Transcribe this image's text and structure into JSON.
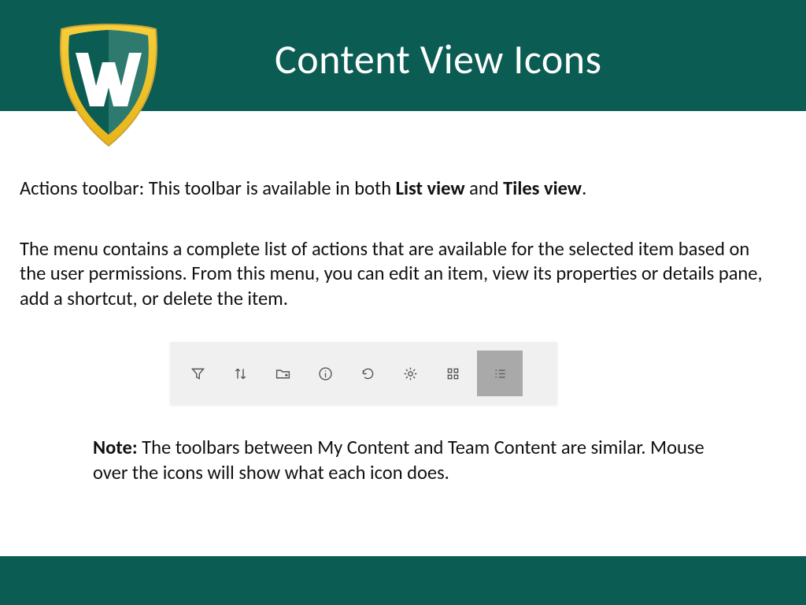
{
  "header": {
    "title": "Content View Icons"
  },
  "paragraphs": {
    "p1_a": "Actions toolbar: This toolbar is available in both ",
    "p1_b1": "List view",
    "p1_c": " and ",
    "p1_b2": "Tiles view",
    "p1_d": ".",
    "p2": "The menu contains a complete list of actions that are available for the selected item based on the user permissions. From this menu, you can edit an item, view its properties or details pane, add a shortcut, or delete the item."
  },
  "note": {
    "label": "Note:",
    "text": " The toolbars between My Content and Team Content are similar. Mouse over the icons will show what each icon does."
  },
  "toolbar": {
    "items": [
      {
        "name": "filter-icon",
        "active": false
      },
      {
        "name": "sort-icon",
        "active": false
      },
      {
        "name": "new-folder-icon",
        "active": false
      },
      {
        "name": "info-icon",
        "active": false
      },
      {
        "name": "refresh-icon",
        "active": false
      },
      {
        "name": "settings-icon",
        "active": false
      },
      {
        "name": "tiles-view-icon",
        "active": false
      },
      {
        "name": "list-view-icon",
        "active": true
      }
    ]
  }
}
